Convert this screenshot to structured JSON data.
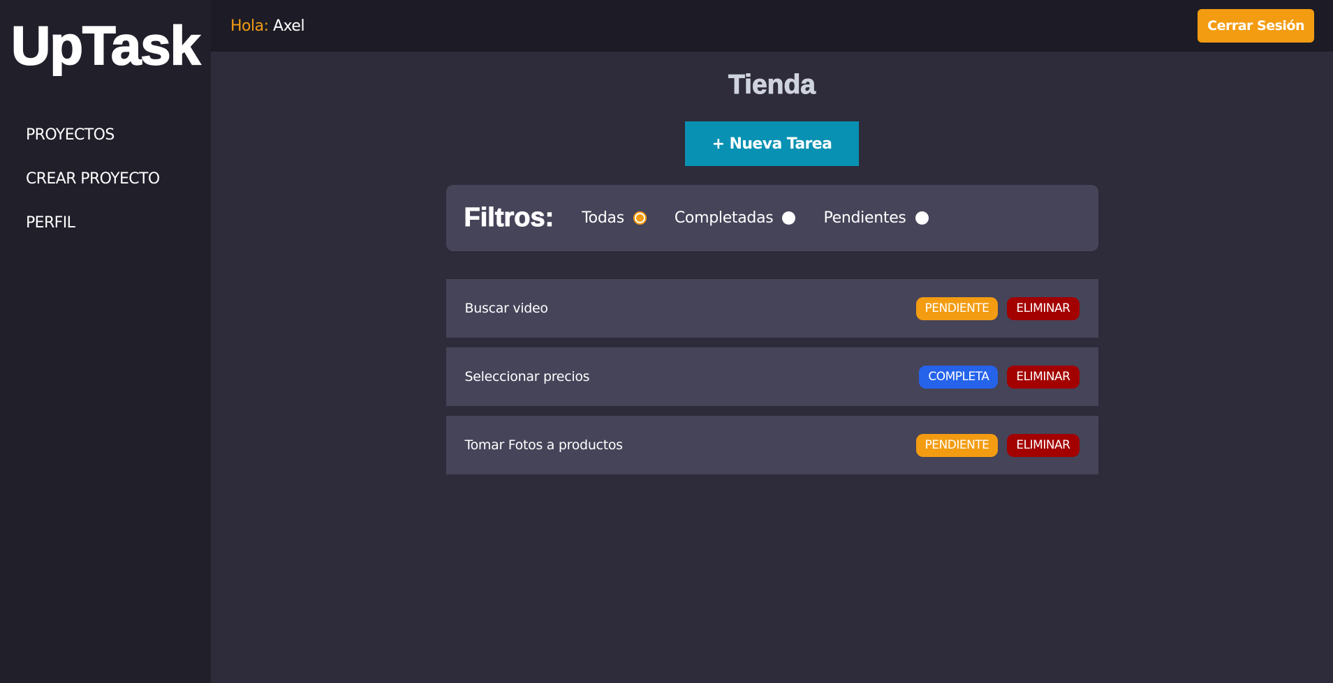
{
  "sidebar": {
    "logo": "UpTask",
    "items": [
      {
        "label": "PROYECTOS"
      },
      {
        "label": "CREAR PROYECTO"
      },
      {
        "label": "PERFIL"
      }
    ]
  },
  "topbar": {
    "greeting_prefix": "Hola:",
    "user_name": "Axel",
    "logout_label": "Cerrar Sesión"
  },
  "main": {
    "title": "Tienda",
    "new_task_label": "+ Nueva Tarea",
    "filters": {
      "title": "Filtros:",
      "options": [
        {
          "label": "Todas",
          "checked": true
        },
        {
          "label": "Completadas",
          "checked": false
        },
        {
          "label": "Pendientes",
          "checked": false
        }
      ]
    },
    "tasks": [
      {
        "name": "Buscar video",
        "status": "PENDIENTE",
        "delete_label": "ELIMINAR"
      },
      {
        "name": "Seleccionar precios",
        "status": "COMPLETA",
        "delete_label": "ELIMINAR"
      },
      {
        "name": "Tomar Fotos a productos",
        "status": "PENDIENTE",
        "delete_label": "ELIMINAR"
      }
    ]
  },
  "colors": {
    "accent": "#f39c12",
    "primary_button": "#0891b2",
    "complete": "#2563eb",
    "delete": "#a30000",
    "sidebar_bg": "#201f2a",
    "main_bg": "#2e2c3a",
    "card_bg": "#464459"
  }
}
